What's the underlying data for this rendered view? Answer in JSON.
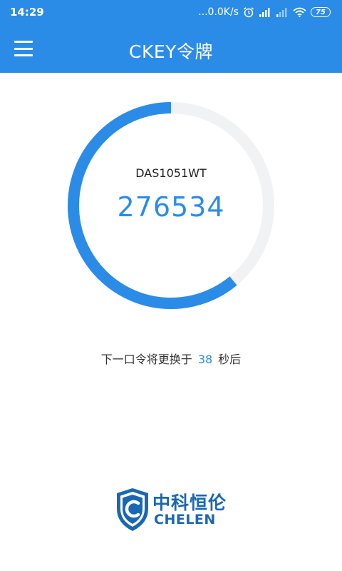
{
  "status_bar": {
    "time": "14:29",
    "net_speed": "...0.0K/s",
    "battery": "75",
    "icons": [
      "alarm-icon",
      "signal-icon",
      "signal-weak-icon",
      "wifi-icon",
      "battery-icon"
    ]
  },
  "app_bar": {
    "title": "CKEY令牌",
    "menu_icon": "menu-icon"
  },
  "token": {
    "device": "DAS1051WT",
    "code": "276534",
    "progress_fraction": 0.61
  },
  "countdown": {
    "prefix": "下一口令将更换于",
    "seconds": "38",
    "suffix": "秒后"
  },
  "logo": {
    "name_cn": "中科恒伦",
    "name_en": "CHELEN"
  },
  "colors": {
    "primary": "#2b8ce7",
    "ring_track": "#f1f2f4",
    "logo_blue": "#1a67b3"
  }
}
